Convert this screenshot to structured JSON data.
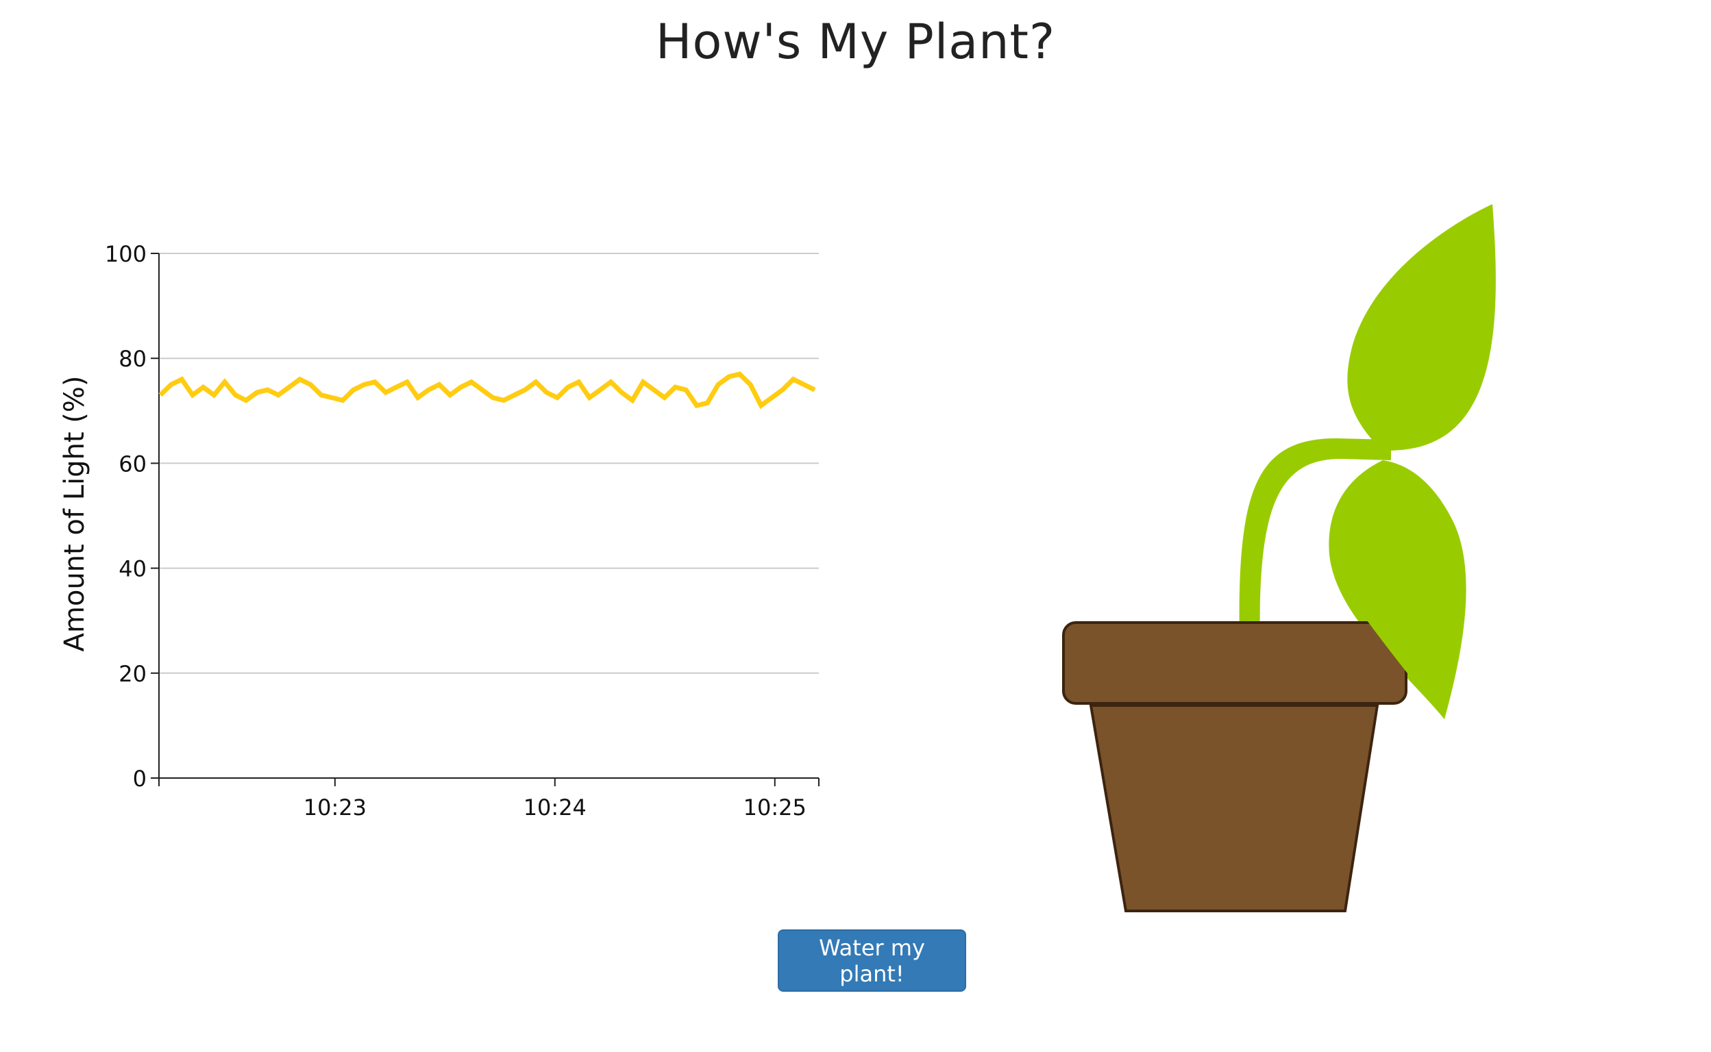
{
  "page": {
    "title": "How's My Plant?"
  },
  "actions": {
    "water_label": "Water my plant!"
  },
  "colors": {
    "line": "#ffcc11",
    "grid": "#cccccc",
    "axis": "#222222",
    "leaf": "#99cc00",
    "pot": "#7a532b",
    "pot_outline": "#3d2410",
    "button": "#337ab7"
  },
  "chart_data": {
    "type": "line",
    "ylabel": "Amount of Light (%)",
    "xlabel": "",
    "ylim": [
      0,
      100
    ],
    "yticks": [
      0,
      20,
      40,
      60,
      80,
      100
    ],
    "xticks": [
      "10:23",
      "10:24",
      "10:25"
    ],
    "grid": true,
    "series": [
      {
        "values": [
          73,
          75,
          76,
          73,
          74.5,
          73,
          75.5,
          73,
          72,
          73.5,
          74,
          73,
          74.5,
          76,
          75,
          73,
          72.5,
          72,
          74,
          75,
          75.5,
          73.5,
          74.5,
          75.5,
          72.5,
          74,
          75,
          73,
          74.5,
          75.5,
          74,
          72.5,
          72,
          73,
          74,
          75.5,
          73.5,
          72.5,
          74.5,
          75.5,
          72.5,
          74,
          75.5,
          73.5,
          72,
          75.5,
          74,
          72.5,
          74.5,
          74,
          71,
          71.5,
          75,
          76.5,
          77,
          75,
          71,
          72.5,
          74,
          76,
          75,
          74
        ]
      }
    ]
  }
}
